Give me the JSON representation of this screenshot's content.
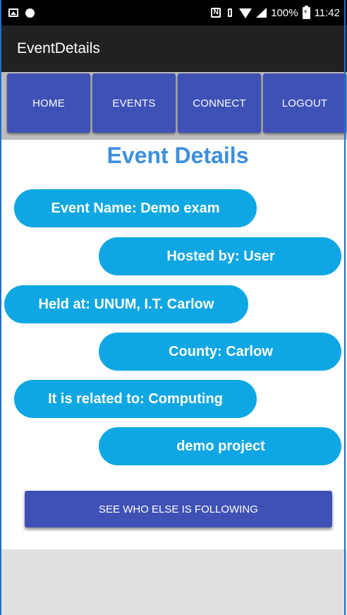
{
  "status_bar": {
    "icons_left": [
      "image-icon",
      "circle-icon"
    ],
    "icons_right": [
      "nfc-icon",
      "vibrate-icon",
      "wifi-icon",
      "signal-icon"
    ],
    "battery": "100%",
    "time": "11:42"
  },
  "app_bar": {
    "title": "EventDetails"
  },
  "nav": {
    "tabs": [
      {
        "label": "HOME"
      },
      {
        "label": "EVENTS"
      },
      {
        "label": "CONNECT"
      },
      {
        "label": "LOGOUT"
      }
    ]
  },
  "details": {
    "heading": "Event Details",
    "event_name": "Event Name: Demo exam",
    "hosted_by": "Hosted by: User",
    "held_at": "Held at: UNUM, I.T. Carlow",
    "county": "County: Carlow",
    "related_to": "It is related to: Computing",
    "description": "demo project"
  },
  "actions": {
    "follow_button": "SEE WHO ELSE IS FOLLOWING"
  },
  "colors": {
    "primary": "#3f51b5",
    "pill": "#0ea7e3",
    "heading": "#3d8fe0",
    "app_bar": "#212121"
  }
}
